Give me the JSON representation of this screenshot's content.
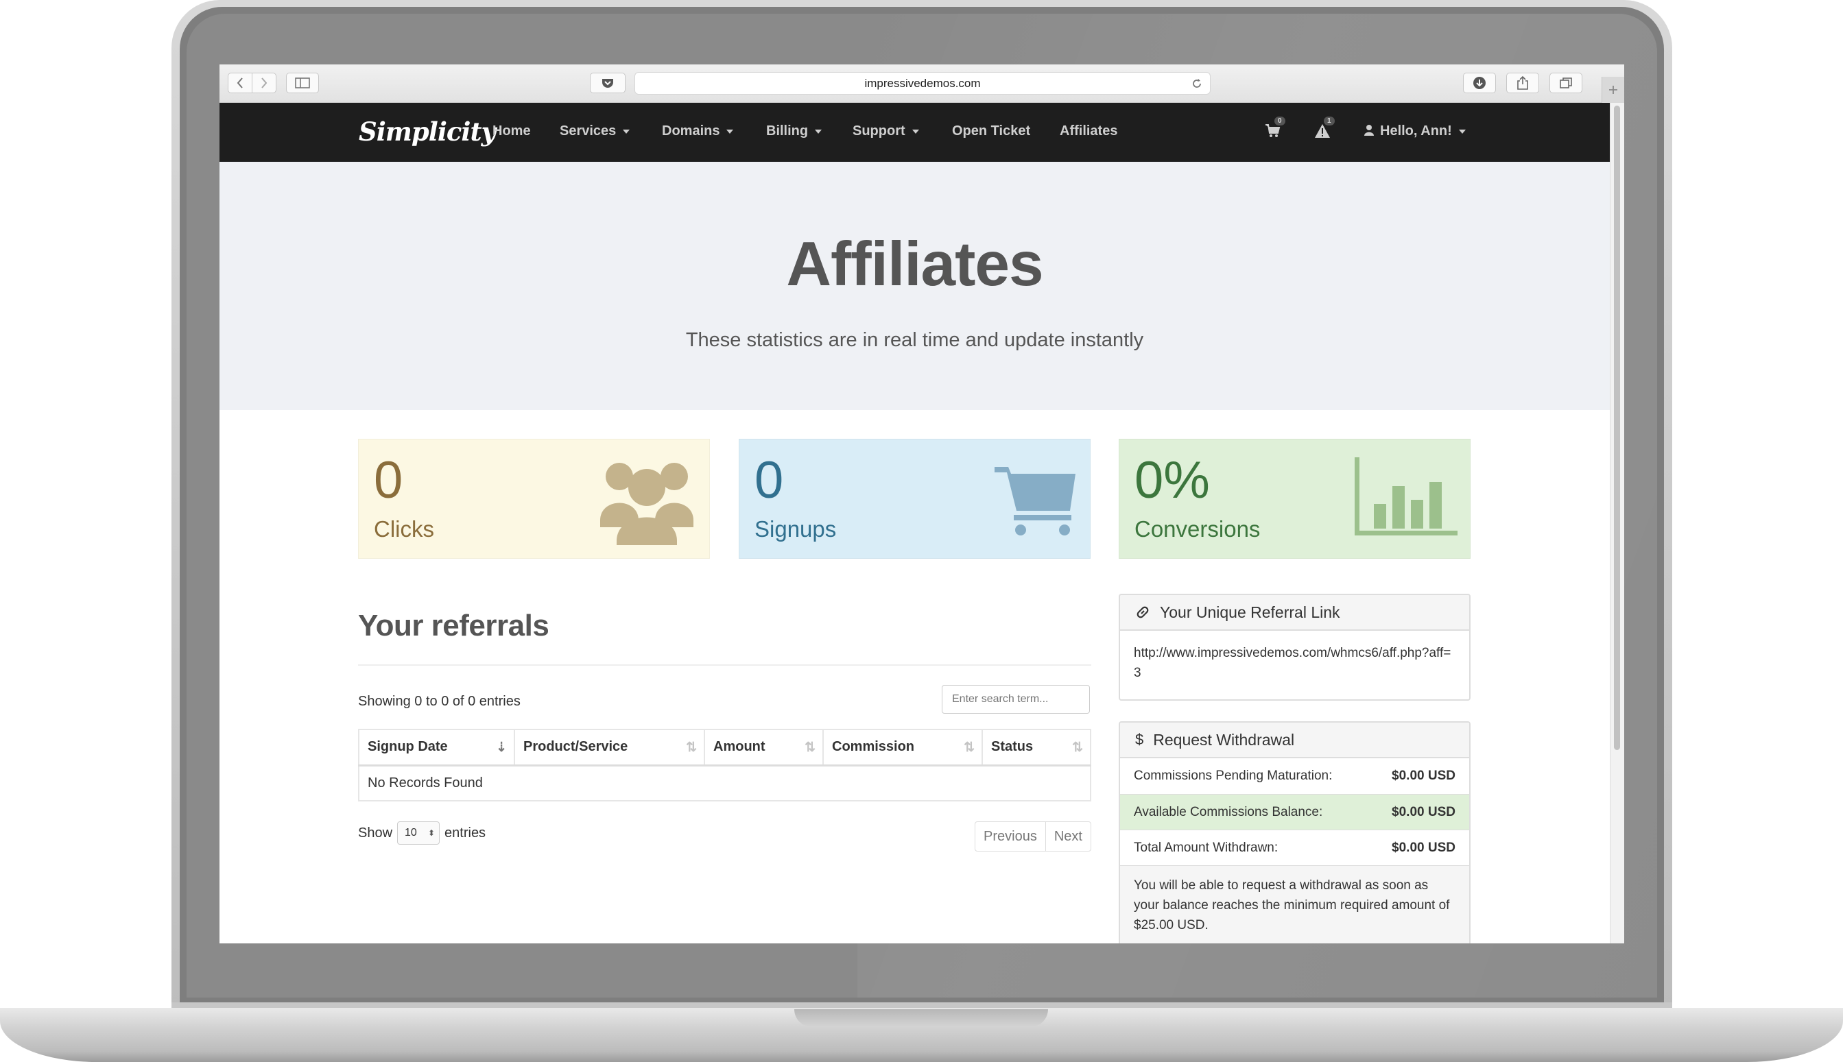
{
  "browser": {
    "url": "impressivedemos.com",
    "back_icon": "chevron-left-icon",
    "forward_icon": "chevron-right-icon",
    "sidebar_icon": "sidebar-icon",
    "pocket_icon": "pocket-icon",
    "reload_icon": "reload-icon",
    "download_icon": "download-icon",
    "share_icon": "share-icon",
    "tabs_icon": "tabs-icon",
    "new_tab_icon": "plus-icon"
  },
  "navbar": {
    "brand": "Simplicity",
    "items": [
      {
        "label": "Home"
      },
      {
        "label": "Services"
      },
      {
        "label": "Domains"
      },
      {
        "label": "Billing"
      },
      {
        "label": "Support"
      },
      {
        "label": "Open Ticket"
      },
      {
        "label": "Affiliates"
      }
    ],
    "cart_count": "0",
    "alert_count": "1",
    "user_label": "Hello, Ann!",
    "background": "#1e1e1e"
  },
  "hero": {
    "title": "Affiliates",
    "subtitle": "These statistics are in real time and update instantly"
  },
  "stats": [
    {
      "value": "0",
      "label": "Clicks",
      "icon": "users-icon",
      "bg": "#fcf8e3",
      "color": "#8a6d3b"
    },
    {
      "value": "0",
      "label": "Signups",
      "icon": "shopping-cart-icon",
      "bg": "#d9edf7",
      "color": "#31708f"
    },
    {
      "value": "0%",
      "label": "Conversions",
      "icon": "bar-chart-icon",
      "bg": "#dff0d8",
      "color": "#3c763d"
    }
  ],
  "referrals": {
    "title": "Your referrals",
    "showing": "Showing 0 to 0 of 0 entries",
    "search_placeholder": "Enter search term...",
    "columns": [
      "Signup Date",
      "Product/Service",
      "Amount",
      "Commission",
      "Status"
    ],
    "empty_message": "No Records Found",
    "show_label": "Show",
    "page_size": "10",
    "entries_label": "entries",
    "prev_label": "Previous",
    "next_label": "Next"
  },
  "referral_link": {
    "title": "Your Unique Referral Link",
    "icon": "link-icon",
    "url": "http://www.impressivedemos.com/whmcs6/aff.php?aff=3"
  },
  "withdrawal": {
    "title": "Request Withdrawal",
    "icon": "dollar-icon",
    "rows": [
      {
        "label": "Commissions Pending Maturation:",
        "value": "$0.00 USD"
      },
      {
        "label": "Available Commissions Balance:",
        "value": "$0.00 USD",
        "highlight": "#dff0d8"
      },
      {
        "label": "Total Amount Withdrawn:",
        "value": "$0.00 USD"
      }
    ],
    "note": "You will be able to request a withdrawal as soon as your balance reaches the minimum required amount of $25.00 USD."
  }
}
